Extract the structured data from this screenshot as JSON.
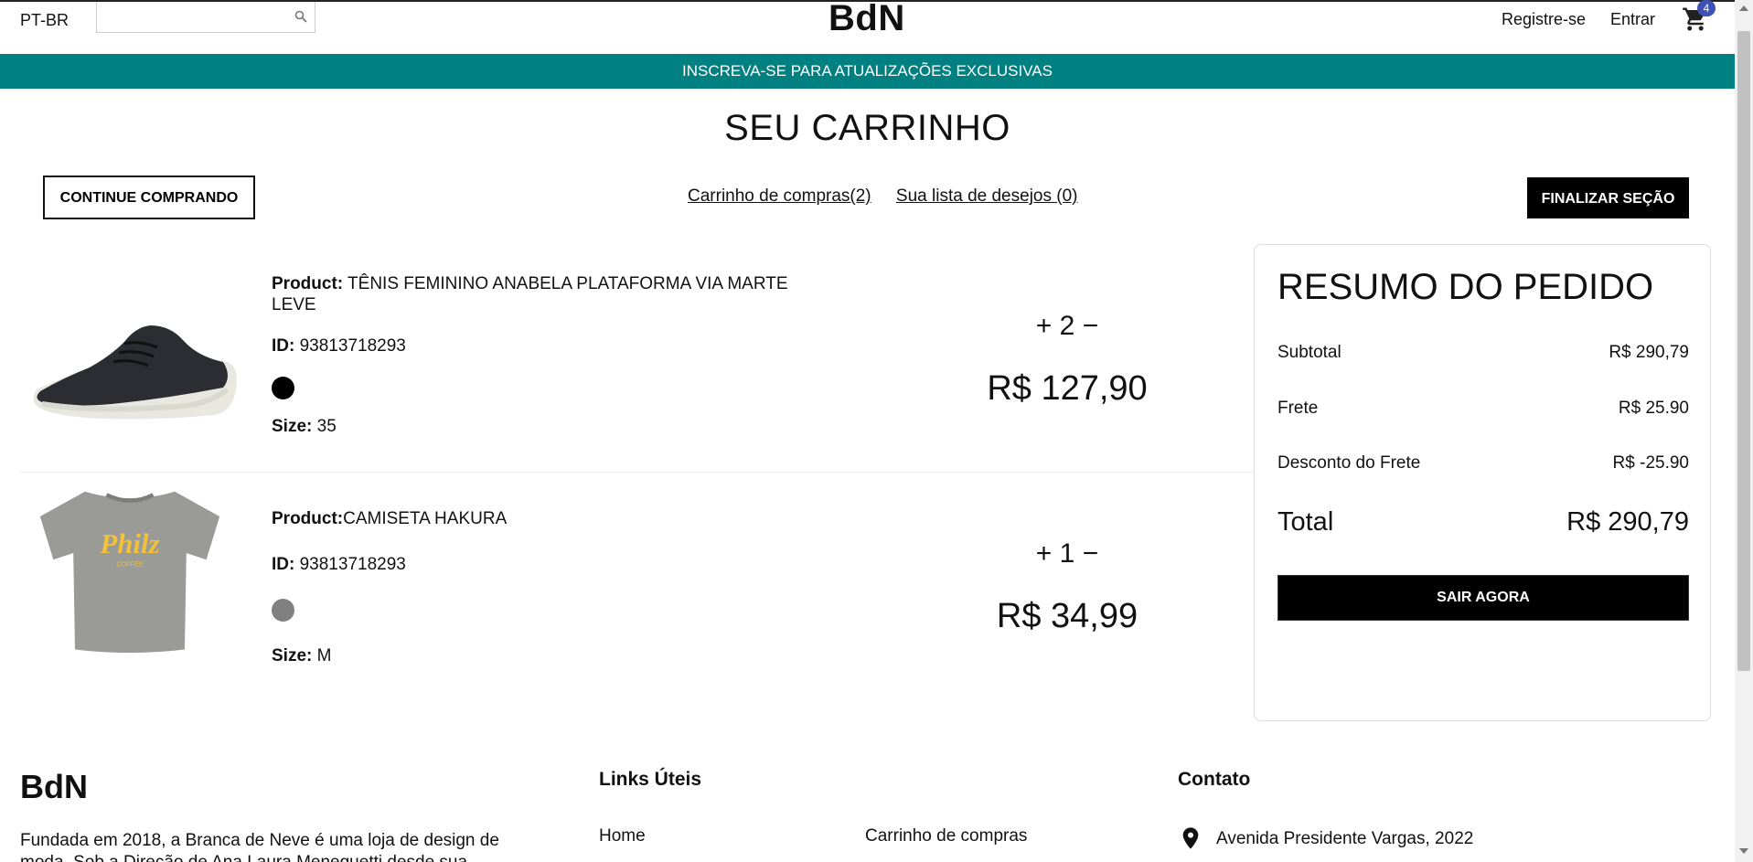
{
  "header": {
    "language": "PT-BR",
    "search_placeholder": "",
    "brand": "BdN",
    "register_label": "Registre-se",
    "login_label": "Entrar",
    "cart_icon": "shopping-cart-icon",
    "cart_count": "4"
  },
  "promo": {
    "text": "INSCREVA-SE PARA ATUALIZAÇÕES EXCLUSIVAS",
    "color": "#008080"
  },
  "cart_page": {
    "title": "SEU CARRINHO",
    "continue_label": "CONTINUE COMPRANDO",
    "tab_cart": "Carrinho de compras(2)",
    "tab_wishlist": "Sua lista de desejos (0)",
    "finalize_label": "FINALIZAR SEÇÃO"
  },
  "items": [
    {
      "product_label": "Product:",
      "product_name": " TÊNIS FEMININO ANABELA PLATAFORMA VIA MARTE",
      "product_name_line2": "LEVE",
      "id_label": "ID:",
      "id_value": " 93813718293",
      "color": "#000000",
      "size_label": "Size:",
      "size_value": " 35",
      "plus": "+",
      "quantity": "2",
      "minus": "−",
      "price": "R$ 127,90"
    },
    {
      "product_label": "Product:",
      "product_name": "CAMISETA HAKURA",
      "id_label": "ID:",
      "id_value": " 93813718293",
      "color": "#808080",
      "size_label": "Size:",
      "size_value": " M",
      "plus": "+",
      "quantity": "1",
      "minus": "−",
      "price": "R$ 34,99",
      "shirt_text": "Philz",
      "shirt_subtext": "COFFEE"
    }
  ],
  "summary": {
    "title": "RESUMO DO PEDIDO",
    "subtotal_label": "Subtotal",
    "subtotal_value": "R$ 290,79",
    "shipping_label": "Frete",
    "shipping_value": "R$ 25.90",
    "discount_label": "Desconto do Frete",
    "discount_value": "R$ -25.90",
    "total_label": "Total",
    "total_value": "R$ 290,79",
    "checkout_label": "SAIR AGORA"
  },
  "footer": {
    "brand": "BdN",
    "about": "Fundada em 2018, a Branca de Neve é uma loja de design de moda. Sob a Direção de Ana Laura Meneguetti desde sua",
    "links_heading": "Links Úteis",
    "link_home": "Home",
    "link_cart": "Carrinho de compras",
    "contact_heading": "Contato",
    "address": "Avenida Presidente Vargas, 2022"
  }
}
